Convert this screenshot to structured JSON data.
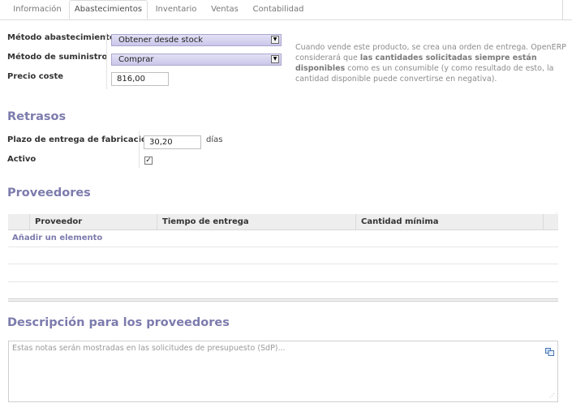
{
  "tabs": [
    {
      "label": "Información"
    },
    {
      "label": "Abastecimientos"
    },
    {
      "label": "Inventario"
    },
    {
      "label": "Ventas"
    },
    {
      "label": "Contabilidad"
    }
  ],
  "procurement": {
    "method_label": "Método abastecimiento",
    "method_value": "Obtener desde stock",
    "supply_label": "Método de suministro",
    "supply_value": "Comprar",
    "cost_label": "Precio coste",
    "cost_value": "816,00",
    "help_1": "Cuando vende este producto, se crea una orden de entrega. OpenERP",
    "help_2a": "considerará que ",
    "help_2b": "las cantidades solicitadas siempre están",
    "help_3a": "disponibles",
    "help_3b": " como es un consumible (y como resultado de esto, la",
    "help_4": "cantidad disponible puede convertirse en negativa)."
  },
  "delays": {
    "title": "Retrasos",
    "lead_label": "Plazo de entrega de fabricación",
    "lead_value": "30,20",
    "lead_unit": "días",
    "active_label": "Activo",
    "active_checked": true
  },
  "suppliers": {
    "title": "Proveedores",
    "columns": [
      "Proveedor",
      "Tiempo de entrega",
      "Cantidad mínima"
    ],
    "add_label": "Añadir un elemento"
  },
  "description": {
    "title": "Descripción para los proveedores",
    "placeholder": "Estas notas serán mostradas en las solicitudes de presupuesto (SdP)..."
  }
}
